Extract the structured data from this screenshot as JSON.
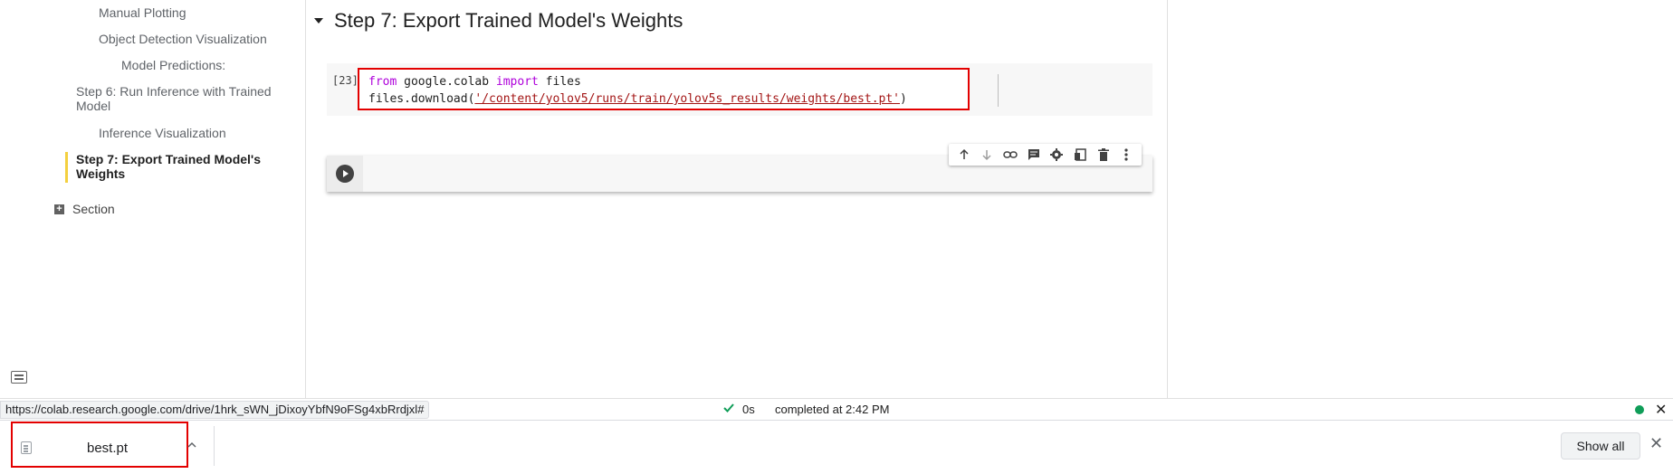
{
  "toc": {
    "items": [
      {
        "label": "Manual Plotting"
      },
      {
        "label": "Object Detection Visualization"
      },
      {
        "label": "Model Predictions:"
      },
      {
        "label": "Step 6: Run Inference with Trained Model"
      },
      {
        "label": "Inference Visualization"
      },
      {
        "label": "Step 7: Export Trained Model's Weights"
      },
      {
        "label": "Section"
      }
    ],
    "active_index": 5
  },
  "main": {
    "section_title": "Step 7: Export Trained Model's Weights",
    "code_cell": {
      "execution_count": "[23]",
      "line1": {
        "kw1": "from",
        "mod": " google.colab ",
        "kw2": "import",
        "name": " files"
      },
      "line2": {
        "prefix": "files.download(",
        "str": "'/content/yolov5/runs/train/yolov5s_results/weights/best.pt'",
        "suffix": ")"
      }
    },
    "cell_toolbar": [
      "move-up-icon",
      "move-down-icon",
      "link-icon",
      "comment-icon",
      "settings-icon",
      "mirror-cell-icon",
      "delete-icon",
      "more-vert-icon"
    ]
  },
  "status_bar": {
    "url": "https://colab.research.google.com/drive/1hrk_sWN_jDixoyYbfN9oFSg4xbRrdjxl#",
    "duration": "0s",
    "completed": "completed at 2:42 PM",
    "indicator_color": "#0f9d58",
    "close_symbol": "✕"
  },
  "download_shelf": {
    "file_name": "best.pt",
    "show_all_label": "Show all",
    "close_symbol": "✕"
  },
  "colors": {
    "highlight_red": "#e30000",
    "active_toc_bar": "#f4d03f",
    "keyword": "#af00db",
    "string": "#a31515"
  }
}
